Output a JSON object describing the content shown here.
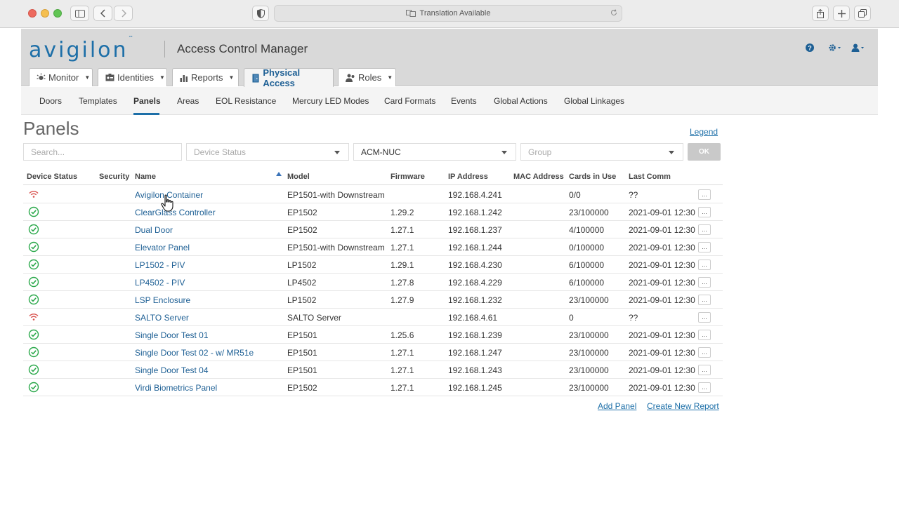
{
  "browser": {
    "url_text": "Translation Available"
  },
  "app": {
    "logo": "avigilon",
    "logo_tm": "™",
    "title": "Access Control Manager",
    "accent": "#1d6fa8"
  },
  "main_tabs": [
    {
      "label": "Monitor",
      "icon": "monitor-icon"
    },
    {
      "label": "Identities",
      "icon": "id-card-icon"
    },
    {
      "label": "Reports",
      "icon": "bar-chart-icon"
    },
    {
      "label": "Physical Access",
      "icon": "door-icon",
      "active": true
    },
    {
      "label": "Roles",
      "icon": "roles-icon"
    }
  ],
  "sub_nav": [
    "Doors",
    "Templates",
    "Panels",
    "Areas",
    "EOL Resistance",
    "Mercury LED Modes",
    "Card Formats",
    "Events",
    "Global Actions",
    "Global Linkages"
  ],
  "page": {
    "title": "Panels",
    "legend": "Legend"
  },
  "filters": {
    "search_placeholder": "Search...",
    "device_status": "Device Status",
    "appliance": "ACM-NUC",
    "group": "Group",
    "ok": "OK"
  },
  "table": {
    "headers": [
      "Device Status",
      "Security",
      "Name",
      "Model",
      "Firmware",
      "IP Address",
      "MAC Address",
      "Cards in Use",
      "Last Comm"
    ],
    "rows": [
      {
        "status": "offline",
        "name": "Avigilon Container",
        "model": "EP1501-with Downstream",
        "firmware": "",
        "ip": "192.168.4.241",
        "cards": "0/0",
        "last": "??",
        "more": "..."
      },
      {
        "status": "online",
        "name": "ClearGlass Controller",
        "model": "EP1502",
        "firmware": "1.29.2",
        "ip": "192.168.1.242",
        "cards": "23/100000",
        "last": "2021-09-01 12:30",
        "more": "..."
      },
      {
        "status": "online",
        "name": "Dual Door",
        "model": "EP1502",
        "firmware": "1.27.1",
        "ip": "192.168.1.237",
        "cards": "4/100000",
        "last": "2021-09-01 12:30",
        "more": "..."
      },
      {
        "status": "online",
        "name": "Elevator Panel",
        "model": "EP1501-with Downstream",
        "firmware": "1.27.1",
        "ip": "192.168.1.244",
        "cards": "0/100000",
        "last": "2021-09-01 12:30",
        "more": "..."
      },
      {
        "status": "online",
        "name": "LP1502 - PIV",
        "model": "LP1502",
        "firmware": "1.29.1",
        "ip": "192.168.4.230",
        "cards": "6/100000",
        "last": "2021-09-01 12:30",
        "more": "..."
      },
      {
        "status": "online",
        "name": "LP4502 - PIV",
        "model": "LP4502",
        "firmware": "1.27.8",
        "ip": "192.168.4.229",
        "cards": "6/100000",
        "last": "2021-09-01 12:30",
        "more": "..."
      },
      {
        "status": "online",
        "name": "LSP Enclosure",
        "model": "LP1502",
        "firmware": "1.27.9",
        "ip": "192.168.1.232",
        "cards": "23/100000",
        "last": "2021-09-01 12:30",
        "more": "..."
      },
      {
        "status": "offline",
        "name": "SALTO Server",
        "model": "SALTO Server",
        "firmware": "",
        "ip": "192.168.4.61",
        "cards": "0",
        "last": "??",
        "more": "..."
      },
      {
        "status": "online",
        "name": "Single Door Test 01",
        "model": "EP1501",
        "firmware": "1.25.6",
        "ip": "192.168.1.239",
        "cards": "23/100000",
        "last": "2021-09-01 12:30",
        "more": "..."
      },
      {
        "status": "online",
        "name": "Single Door Test 02 - w/ MR51e",
        "model": "EP1501",
        "firmware": "1.27.1",
        "ip": "192.168.1.247",
        "cards": "23/100000",
        "last": "2021-09-01 12:30",
        "more": "..."
      },
      {
        "status": "online",
        "name": "Single Door Test 04",
        "model": "EP1501",
        "firmware": "1.27.1",
        "ip": "192.168.1.243",
        "cards": "23/100000",
        "last": "2021-09-01 12:30",
        "more": "..."
      },
      {
        "status": "online",
        "name": "Virdi Biometrics Panel",
        "model": "EP1502",
        "firmware": "1.27.1",
        "ip": "192.168.1.245",
        "cards": "23/100000",
        "last": "2021-09-01 12:30",
        "more": "..."
      }
    ]
  },
  "footer": {
    "add_panel": "Add Panel",
    "create_report": "Create New Report"
  },
  "colors": {
    "online": "#2aa84a",
    "offline": "#d9534f",
    "link": "#1d5f94"
  }
}
